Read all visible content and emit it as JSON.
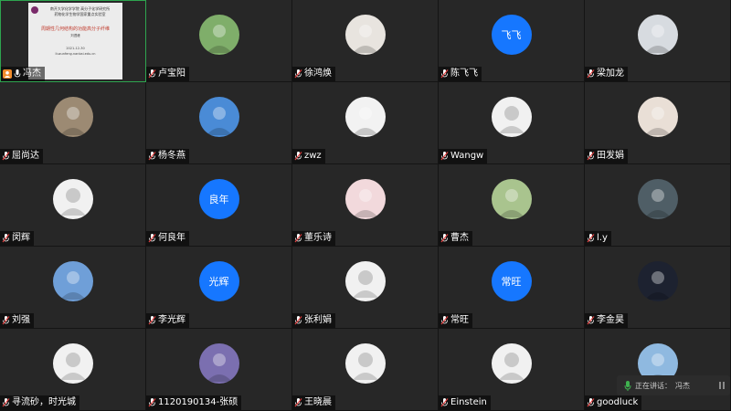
{
  "colors": {
    "tile_bg": "#272727",
    "name_avatar_bg": "#1677ff",
    "speaking_border": "#2ea44f",
    "host_badge": "#f08c2c"
  },
  "tiles": [
    {
      "name": "冯杰",
      "type": "screen",
      "host": true,
      "mic": true
    },
    {
      "name": "卢宝阳",
      "type": "image",
      "bg": "#7fae6a"
    },
    {
      "name": "徐鸿焕",
      "type": "image",
      "bg": "#e8e4df"
    },
    {
      "name": "陈飞飞",
      "type": "text",
      "initials": "飞飞"
    },
    {
      "name": "梁加龙",
      "type": "image",
      "bg": "#d7dbe0"
    },
    {
      "name": "屈尚达",
      "type": "image",
      "bg": "#9c8a73"
    },
    {
      "name": "杨冬燕",
      "type": "image",
      "bg": "#4a8bd6"
    },
    {
      "name": "zwz",
      "type": "image",
      "bg": "#f2f2f2"
    },
    {
      "name": "Wangw",
      "type": "default"
    },
    {
      "name": "田发娟",
      "type": "image",
      "bg": "#e9dfd6"
    },
    {
      "name": "闵辉",
      "type": "default"
    },
    {
      "name": "何良年",
      "type": "text",
      "initials": "良年"
    },
    {
      "name": "董乐诗",
      "type": "image",
      "bg": "#f2d9dc"
    },
    {
      "name": "曹杰",
      "type": "image",
      "bg": "#a9c48e"
    },
    {
      "name": "l.y",
      "type": "image",
      "bg": "#4f5e66"
    },
    {
      "name": "刘强",
      "type": "image",
      "bg": "#6f9fd8"
    },
    {
      "name": "李光辉",
      "type": "text",
      "initials": "光辉"
    },
    {
      "name": "张利娟",
      "type": "default"
    },
    {
      "name": "常旺",
      "type": "text",
      "initials": "常旺"
    },
    {
      "name": "李金昊",
      "type": "image",
      "bg": "#1d2230"
    },
    {
      "name": "寻流砂，时光城",
      "type": "default"
    },
    {
      "name": "1120190134-张硕",
      "type": "image",
      "bg": "#7b6fb0"
    },
    {
      "name": "王晓晨",
      "type": "default"
    },
    {
      "name": "Einstein",
      "type": "default"
    },
    {
      "name": "goodluck",
      "type": "image",
      "bg": "#8fb9e0"
    }
  ],
  "slide": {
    "header_line1": "南开大学化学学院 高分子化学研究所",
    "header_line2": "药物化学生物学国家重点实验室",
    "title": "周期性几何结构的功能高分子纤维",
    "author": "刘遵峰",
    "date": "2021-12-30",
    "email": "liuzunfeng.nankai.edu.cn"
  },
  "speaking": {
    "label": "正在讲话：",
    "name": "冯杰"
  }
}
